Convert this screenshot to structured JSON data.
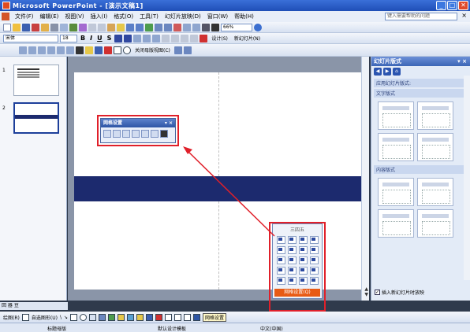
{
  "window": {
    "title": "Microsoft PowerPoint - [演示文稿1]",
    "min_label": "_",
    "max_label": "□",
    "close_label": "✕"
  },
  "menubar": {
    "items": [
      "文件(F)",
      "编辑(E)",
      "视图(V)",
      "插入(I)",
      "格式(O)",
      "工具(T)",
      "幻灯片放映(D)",
      "窗口(W)",
      "帮助(H)"
    ],
    "help_placeholder": "键入需要帮助的问题",
    "close_label": "×"
  },
  "toolbar1": {
    "zoom": "66%"
  },
  "toolbar2": {
    "font": "宋体",
    "size": "18",
    "bold": "B",
    "italic": "I",
    "underline": "U",
    "shadow": "S",
    "design_label": "设计(S)",
    "new_slide_label": "新幻灯片(N)"
  },
  "toolbar3": {
    "close_master_label": "关闭母版视图(C)"
  },
  "slides_pane": {
    "thumb1_num": "1",
    "thumb2_num": "2"
  },
  "floating_toolbar": {
    "title": "网格设置"
  },
  "palette": {
    "title": "三四五",
    "footer_label": "网格设置(Q)"
  },
  "task_pane": {
    "title": "幻灯片版式",
    "nav": [
      "◀",
      "▶",
      "⌂"
    ],
    "section1": "应用幻灯片版式:",
    "section1_sub": "文字版式",
    "section2": "内容版式",
    "checkbox_label": "插入新幻灯片时放映",
    "checked": "✓"
  },
  "notes_tab": {
    "label": "回 器 豆"
  },
  "drawbar": {
    "draw_label": "绘图(R)",
    "autoshapes_label": "自选图形(U)",
    "tooltip": "网格设置"
  },
  "statusbar": {
    "left": "标题母版",
    "middle": "默认设计模板",
    "right": "中文(中国)"
  },
  "colors": {
    "title_bar": "#1f4fb7",
    "band": "#1c2a6e",
    "highlight_box": "#e0202a",
    "palette_footer": "#e85a14"
  }
}
